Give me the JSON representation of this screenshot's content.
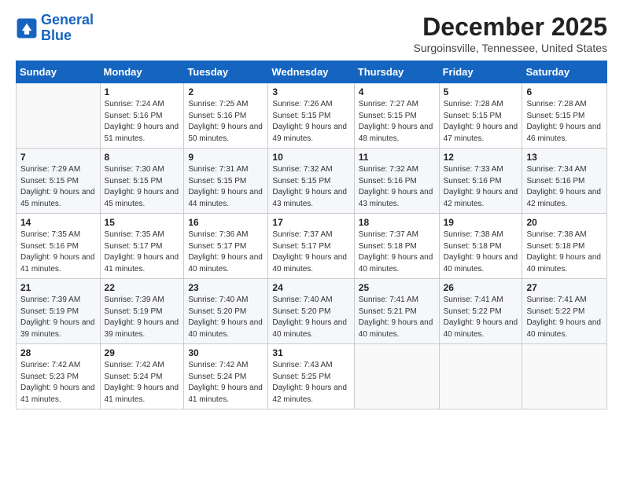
{
  "logo": {
    "line1": "General",
    "line2": "Blue"
  },
  "title": "December 2025",
  "subtitle": "Surgoinsville, Tennessee, United States",
  "weekdays": [
    "Sunday",
    "Monday",
    "Tuesday",
    "Wednesday",
    "Thursday",
    "Friday",
    "Saturday"
  ],
  "weeks": [
    [
      {
        "day": "",
        "sunrise": "",
        "sunset": "",
        "daylight": ""
      },
      {
        "day": "1",
        "sunrise": "Sunrise: 7:24 AM",
        "sunset": "Sunset: 5:16 PM",
        "daylight": "Daylight: 9 hours and 51 minutes."
      },
      {
        "day": "2",
        "sunrise": "Sunrise: 7:25 AM",
        "sunset": "Sunset: 5:16 PM",
        "daylight": "Daylight: 9 hours and 50 minutes."
      },
      {
        "day": "3",
        "sunrise": "Sunrise: 7:26 AM",
        "sunset": "Sunset: 5:15 PM",
        "daylight": "Daylight: 9 hours and 49 minutes."
      },
      {
        "day": "4",
        "sunrise": "Sunrise: 7:27 AM",
        "sunset": "Sunset: 5:15 PM",
        "daylight": "Daylight: 9 hours and 48 minutes."
      },
      {
        "day": "5",
        "sunrise": "Sunrise: 7:28 AM",
        "sunset": "Sunset: 5:15 PM",
        "daylight": "Daylight: 9 hours and 47 minutes."
      },
      {
        "day": "6",
        "sunrise": "Sunrise: 7:28 AM",
        "sunset": "Sunset: 5:15 PM",
        "daylight": "Daylight: 9 hours and 46 minutes."
      }
    ],
    [
      {
        "day": "7",
        "sunrise": "Sunrise: 7:29 AM",
        "sunset": "Sunset: 5:15 PM",
        "daylight": "Daylight: 9 hours and 45 minutes."
      },
      {
        "day": "8",
        "sunrise": "Sunrise: 7:30 AM",
        "sunset": "Sunset: 5:15 PM",
        "daylight": "Daylight: 9 hours and 45 minutes."
      },
      {
        "day": "9",
        "sunrise": "Sunrise: 7:31 AM",
        "sunset": "Sunset: 5:15 PM",
        "daylight": "Daylight: 9 hours and 44 minutes."
      },
      {
        "day": "10",
        "sunrise": "Sunrise: 7:32 AM",
        "sunset": "Sunset: 5:15 PM",
        "daylight": "Daylight: 9 hours and 43 minutes."
      },
      {
        "day": "11",
        "sunrise": "Sunrise: 7:32 AM",
        "sunset": "Sunset: 5:16 PM",
        "daylight": "Daylight: 9 hours and 43 minutes."
      },
      {
        "day": "12",
        "sunrise": "Sunrise: 7:33 AM",
        "sunset": "Sunset: 5:16 PM",
        "daylight": "Daylight: 9 hours and 42 minutes."
      },
      {
        "day": "13",
        "sunrise": "Sunrise: 7:34 AM",
        "sunset": "Sunset: 5:16 PM",
        "daylight": "Daylight: 9 hours and 42 minutes."
      }
    ],
    [
      {
        "day": "14",
        "sunrise": "Sunrise: 7:35 AM",
        "sunset": "Sunset: 5:16 PM",
        "daylight": "Daylight: 9 hours and 41 minutes."
      },
      {
        "day": "15",
        "sunrise": "Sunrise: 7:35 AM",
        "sunset": "Sunset: 5:17 PM",
        "daylight": "Daylight: 9 hours and 41 minutes."
      },
      {
        "day": "16",
        "sunrise": "Sunrise: 7:36 AM",
        "sunset": "Sunset: 5:17 PM",
        "daylight": "Daylight: 9 hours and 40 minutes."
      },
      {
        "day": "17",
        "sunrise": "Sunrise: 7:37 AM",
        "sunset": "Sunset: 5:17 PM",
        "daylight": "Daylight: 9 hours and 40 minutes."
      },
      {
        "day": "18",
        "sunrise": "Sunrise: 7:37 AM",
        "sunset": "Sunset: 5:18 PM",
        "daylight": "Daylight: 9 hours and 40 minutes."
      },
      {
        "day": "19",
        "sunrise": "Sunrise: 7:38 AM",
        "sunset": "Sunset: 5:18 PM",
        "daylight": "Daylight: 9 hours and 40 minutes."
      },
      {
        "day": "20",
        "sunrise": "Sunrise: 7:38 AM",
        "sunset": "Sunset: 5:18 PM",
        "daylight": "Daylight: 9 hours and 40 minutes."
      }
    ],
    [
      {
        "day": "21",
        "sunrise": "Sunrise: 7:39 AM",
        "sunset": "Sunset: 5:19 PM",
        "daylight": "Daylight: 9 hours and 39 minutes."
      },
      {
        "day": "22",
        "sunrise": "Sunrise: 7:39 AM",
        "sunset": "Sunset: 5:19 PM",
        "daylight": "Daylight: 9 hours and 39 minutes."
      },
      {
        "day": "23",
        "sunrise": "Sunrise: 7:40 AM",
        "sunset": "Sunset: 5:20 PM",
        "daylight": "Daylight: 9 hours and 40 minutes."
      },
      {
        "day": "24",
        "sunrise": "Sunrise: 7:40 AM",
        "sunset": "Sunset: 5:20 PM",
        "daylight": "Daylight: 9 hours and 40 minutes."
      },
      {
        "day": "25",
        "sunrise": "Sunrise: 7:41 AM",
        "sunset": "Sunset: 5:21 PM",
        "daylight": "Daylight: 9 hours and 40 minutes."
      },
      {
        "day": "26",
        "sunrise": "Sunrise: 7:41 AM",
        "sunset": "Sunset: 5:22 PM",
        "daylight": "Daylight: 9 hours and 40 minutes."
      },
      {
        "day": "27",
        "sunrise": "Sunrise: 7:41 AM",
        "sunset": "Sunset: 5:22 PM",
        "daylight": "Daylight: 9 hours and 40 minutes."
      }
    ],
    [
      {
        "day": "28",
        "sunrise": "Sunrise: 7:42 AM",
        "sunset": "Sunset: 5:23 PM",
        "daylight": "Daylight: 9 hours and 41 minutes."
      },
      {
        "day": "29",
        "sunrise": "Sunrise: 7:42 AM",
        "sunset": "Sunset: 5:24 PM",
        "daylight": "Daylight: 9 hours and 41 minutes."
      },
      {
        "day": "30",
        "sunrise": "Sunrise: 7:42 AM",
        "sunset": "Sunset: 5:24 PM",
        "daylight": "Daylight: 9 hours and 41 minutes."
      },
      {
        "day": "31",
        "sunrise": "Sunrise: 7:43 AM",
        "sunset": "Sunset: 5:25 PM",
        "daylight": "Daylight: 9 hours and 42 minutes."
      },
      {
        "day": "",
        "sunrise": "",
        "sunset": "",
        "daylight": ""
      },
      {
        "day": "",
        "sunrise": "",
        "sunset": "",
        "daylight": ""
      },
      {
        "day": "",
        "sunrise": "",
        "sunset": "",
        "daylight": ""
      }
    ]
  ]
}
